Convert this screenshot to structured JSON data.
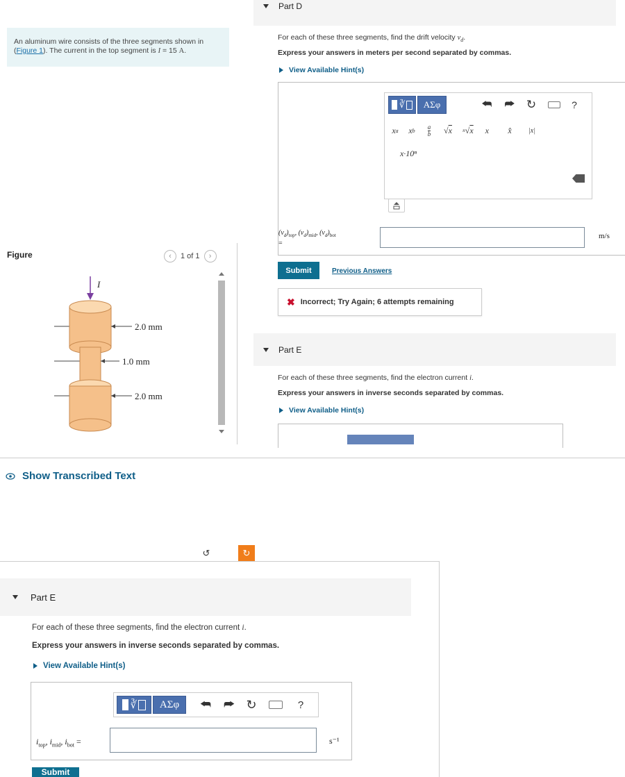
{
  "problem": {
    "text_before": "An aluminum wire consists of the three segments shown in (",
    "figure_link": "Figure 1",
    "text_after": "). The current in the top segment is ",
    "current_var": "I",
    "current_eq": " = 15 ",
    "current_unit": "A",
    "period": "."
  },
  "figure": {
    "label": "Figure",
    "pager": "1 of 1",
    "current_label": "I",
    "dim_top": "2.0 mm",
    "dim_mid": "1.0 mm",
    "dim_bot": "2.0 mm"
  },
  "transcribed": {
    "label": "Show Transcribed Text"
  },
  "partD": {
    "title": "Part D",
    "instruction_prefix": "For each of these three segments, find the drift velocity ",
    "instruction_var": "v",
    "instruction_sub": "d",
    "instruction_suffix": ".",
    "express": "Express your answers in meters per second separated by commas.",
    "hint": "View Available Hint(s)",
    "answer_label": "(v_d)_top, (v_d)_mid, (v_d)_bot =",
    "unit": "m/s",
    "submit": "Submit",
    "previous": "Previous Answers",
    "feedback": "Incorrect; Try Again; 6 attempts remaining"
  },
  "partE": {
    "title": "Part E",
    "instruction_prefix": "For each of these three segments, find the electron current ",
    "instruction_var": "i",
    "instruction_suffix": ".",
    "express": "Express your answers in inverse seconds separated by commas.",
    "hint": "View Available Hint(s)",
    "answer_label": "i_top, i_mid, i_bot =",
    "unit": "s⁻¹",
    "submit": "Submit"
  },
  "toolbar": {
    "greek": "ΑΣφ",
    "help": "?",
    "sci": "x·10ⁿ"
  },
  "colors": {
    "accent": "#0e6f90",
    "template_button": "#4a6fae",
    "problem_bg": "#e8f4f6",
    "error": "#c8102e",
    "figure_cylinder": "#f5c08a",
    "orange_button": "#f07d1a"
  }
}
